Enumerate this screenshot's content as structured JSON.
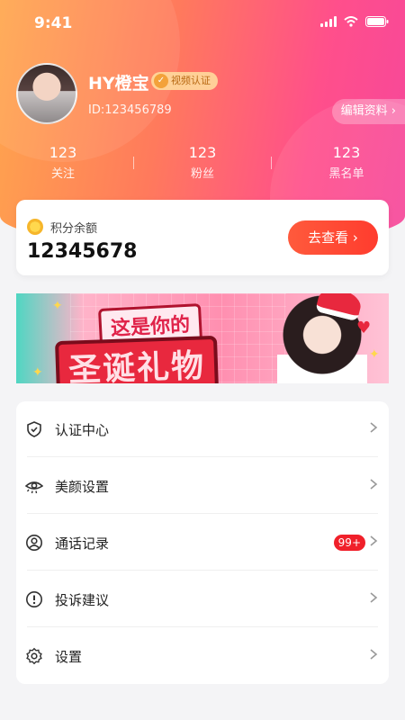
{
  "status_bar": {
    "time": "9:41"
  },
  "profile": {
    "username": "HY橙宝",
    "verify_badge": "视频认证",
    "user_id": "ID:123456789",
    "edit_profile": "编辑资料 ›"
  },
  "stats": [
    {
      "value": "123",
      "label": "关注"
    },
    {
      "value": "123",
      "label": "粉丝"
    },
    {
      "value": "123",
      "label": "黑名单"
    }
  ],
  "points": {
    "label": "积分余额",
    "value": "12345678",
    "button": "去查看 ›"
  },
  "banner": {
    "line1": "这是你的",
    "line2": "圣诞礼物"
  },
  "menu": {
    "items": [
      {
        "label": "认证中心",
        "icon": "shield-check-icon"
      },
      {
        "label": "美颜设置",
        "icon": "eye-icon"
      },
      {
        "label": "通话记录",
        "icon": "user-circle-icon",
        "badge": "99+"
      },
      {
        "label": "投诉建议",
        "icon": "alert-circle-icon"
      },
      {
        "label": "设置",
        "icon": "gear-icon"
      }
    ]
  },
  "colors": {
    "header_start": "#ffa64d",
    "header_end": "#f6479b",
    "button": "#ff3c2e",
    "badge": "#f0202a"
  }
}
